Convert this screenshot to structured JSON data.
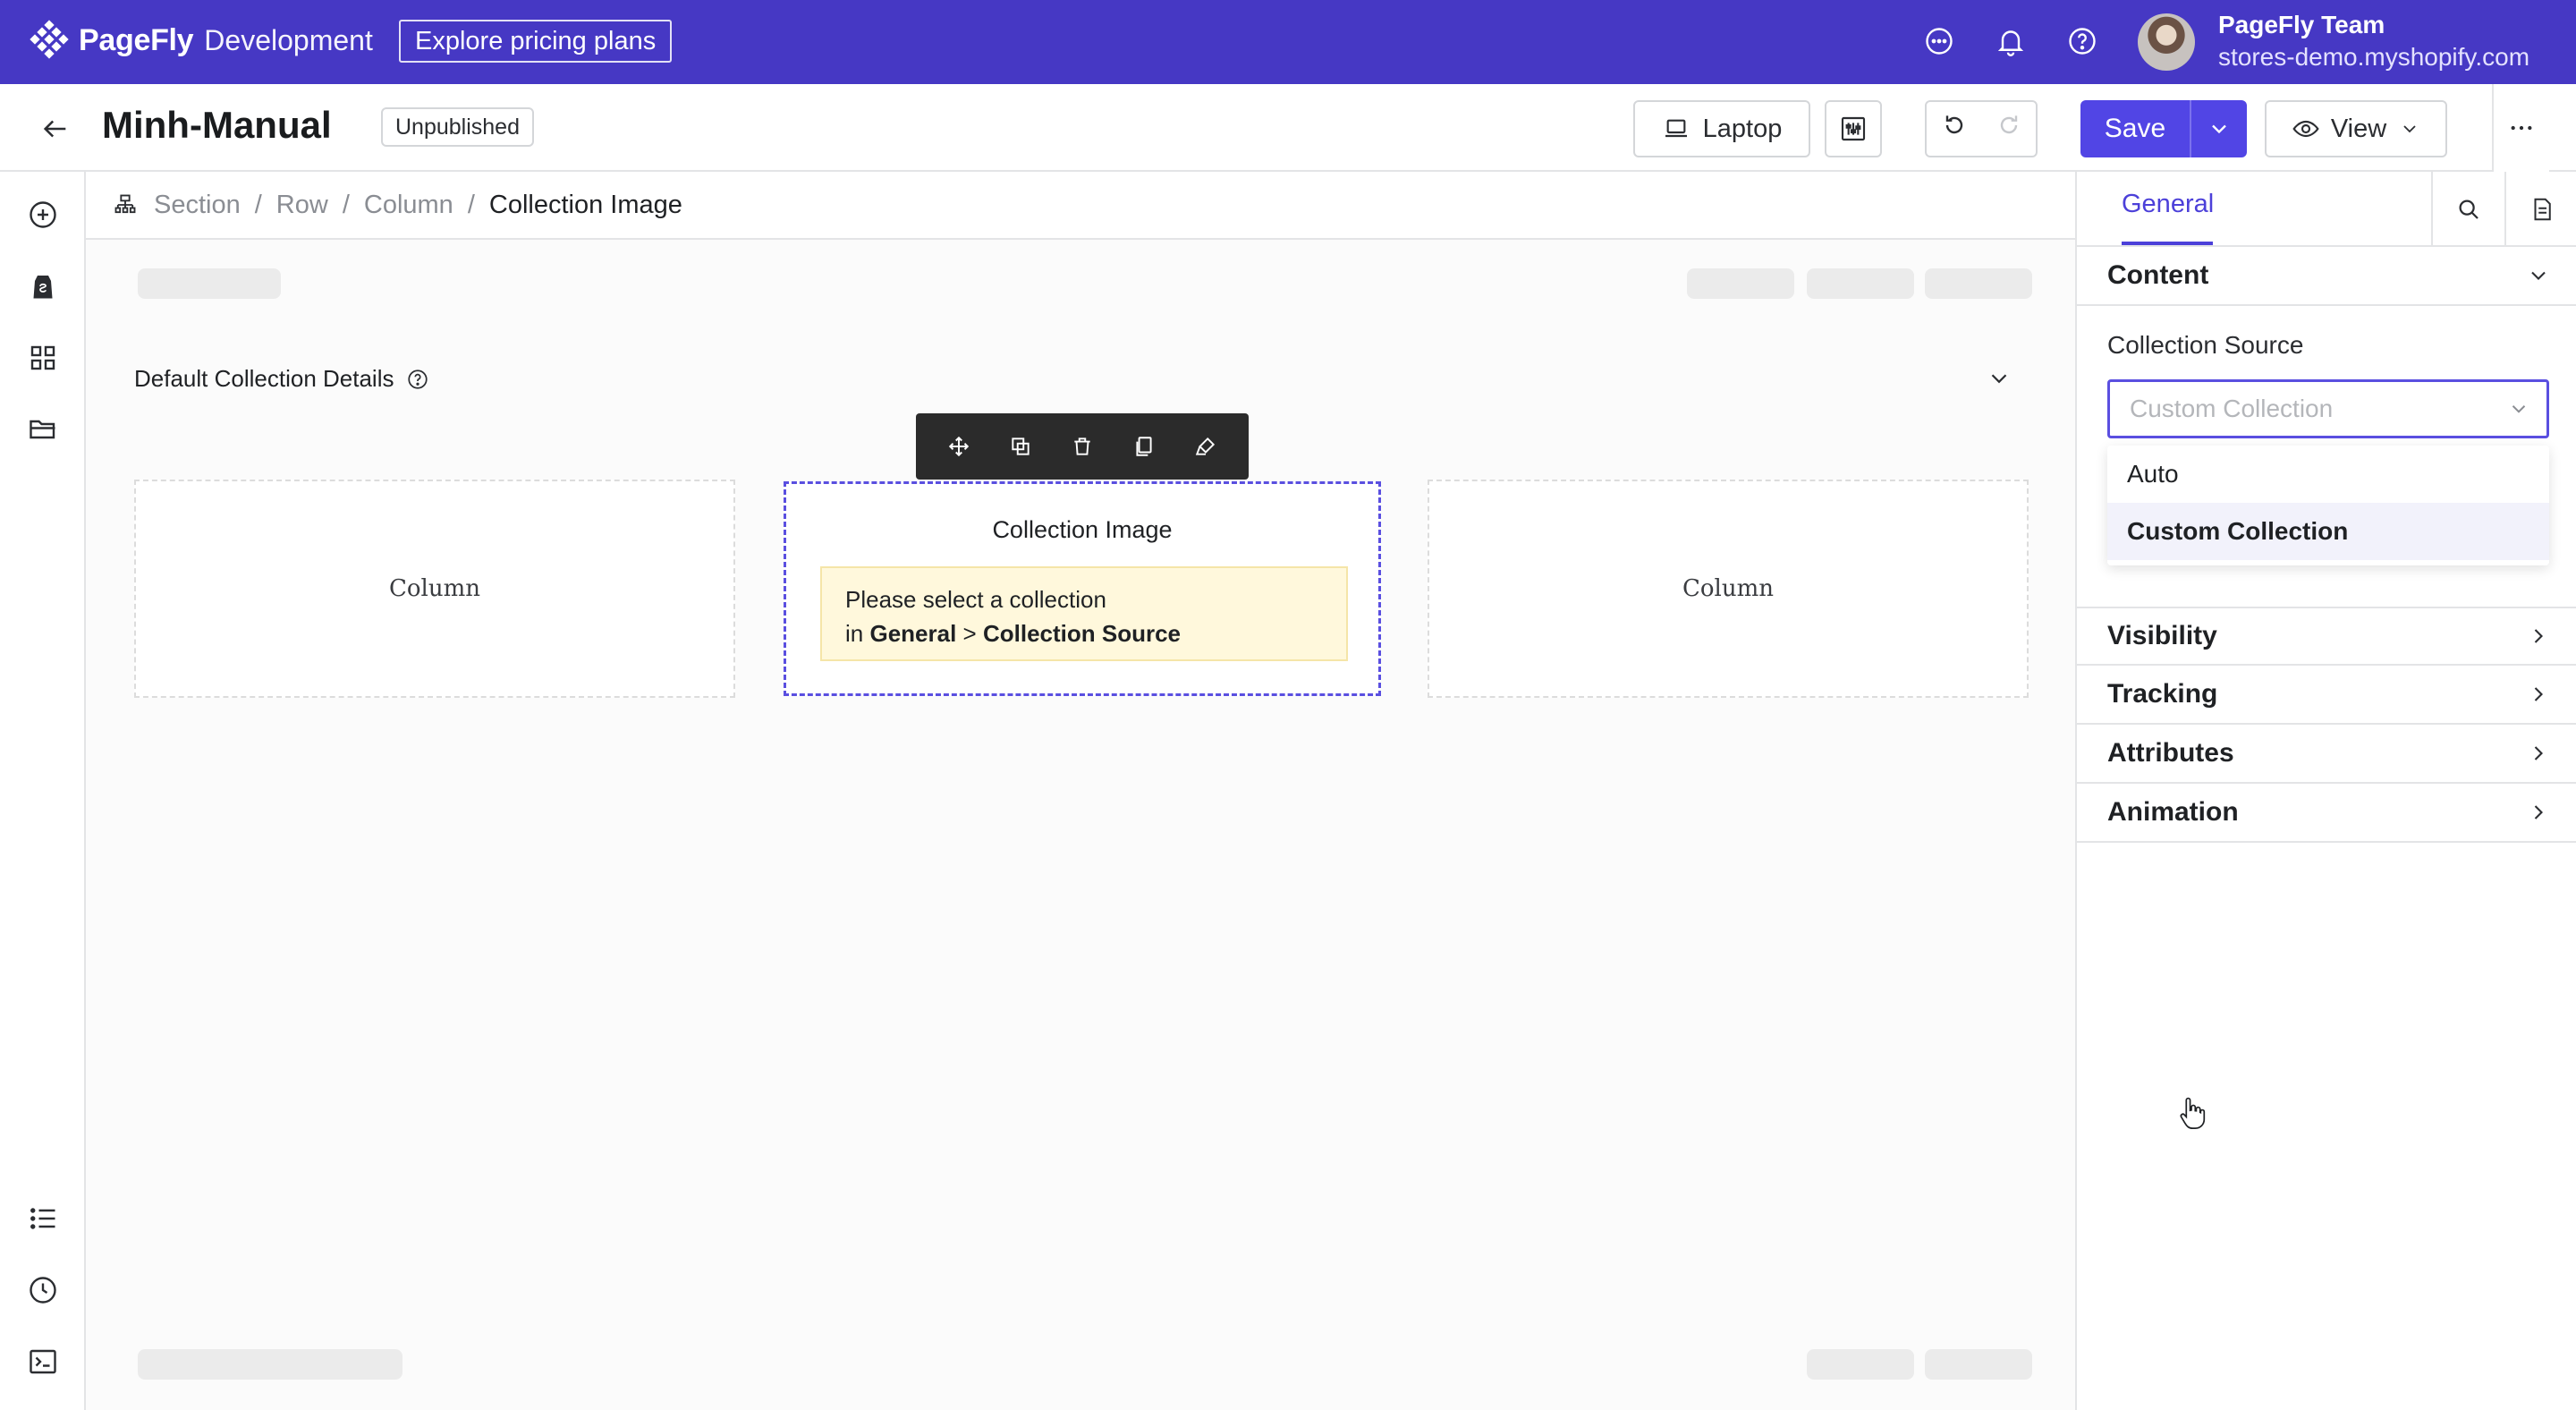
{
  "topbar": {
    "brand": "PageFly",
    "environment": "Development",
    "pricing_button": "Explore pricing plans",
    "icons": [
      "chat-icon",
      "bell-icon",
      "help-icon"
    ],
    "user_name": "PageFly Team",
    "user_store": "stores-demo.myshopify.com",
    "accent_color": "#4638c4"
  },
  "header": {
    "page_title": "Minh-Manual",
    "status": "Unpublished",
    "device_label": "Laptop",
    "save_label": "Save",
    "view_label": "View",
    "primary_color": "#5145e5"
  },
  "left_rail": {
    "icons": [
      "add-element-icon",
      "shopify-icon",
      "grid-icon",
      "folder-icon",
      "list-icon",
      "history-icon",
      "terminal-icon"
    ]
  },
  "breadcrumb": {
    "items": [
      "Section",
      "Row",
      "Column"
    ],
    "current": "Collection Image"
  },
  "canvas": {
    "collection_heading": "Default Collection Details",
    "left_column_label": "Column",
    "right_column_label": "Column",
    "selected_element_title": "Collection Image",
    "warning_line1": "Please select a collection",
    "warning_in": "in",
    "warning_general": "General",
    "warning_gt": ">",
    "warning_source": "Collection Source",
    "toolbar_icons": [
      "move-icon",
      "duplicate-icon",
      "delete-icon",
      "copy-icon",
      "style-icon"
    ]
  },
  "right_panel": {
    "tab": "General",
    "content_section": "Content",
    "field_label": "Collection Source",
    "select_value": "Custom Collection",
    "options": [
      "Auto",
      "Custom Collection"
    ],
    "selected_option": "Custom Collection",
    "sections": [
      "Visibility",
      "Tracking",
      "Attributes",
      "Animation"
    ]
  }
}
